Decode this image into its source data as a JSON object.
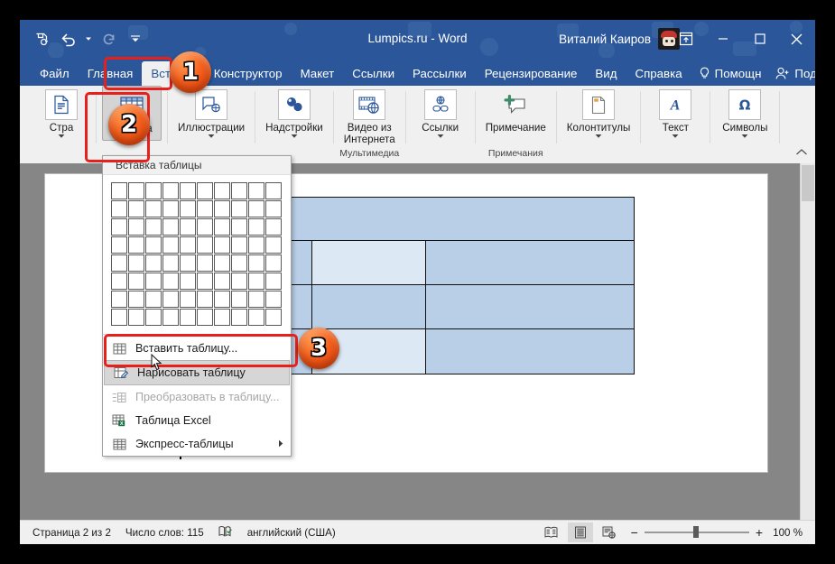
{
  "window": {
    "title": "Lumpics.ru  -  Word",
    "account_name": "Виталий Каиров",
    "controls": {
      "ribbon_display": "ribbon-display-options",
      "minimize": "minimize",
      "maximize": "maximize",
      "close": "close"
    }
  },
  "quick_access": {
    "save_label": "save-sync",
    "undo_label": "undo",
    "redo_label": "redo",
    "customize_label": "customize-quick-access-toolbar"
  },
  "tabs": {
    "items": [
      {
        "label": "Файл",
        "active": false
      },
      {
        "label": "Главная",
        "active": false
      },
      {
        "label": "Вставка",
        "active": true
      },
      {
        "label": "Конструктор",
        "active": false
      },
      {
        "label": "Макет",
        "active": false
      },
      {
        "label": "Ссылки",
        "active": false
      },
      {
        "label": "Рассылки",
        "active": false
      },
      {
        "label": "Рецензирование",
        "active": false
      },
      {
        "label": "Вид",
        "active": false
      },
      {
        "label": "Справка",
        "active": false
      }
    ],
    "tell_me": "Помощн",
    "share": "Поделиться"
  },
  "ribbon": {
    "groups": [
      {
        "label": "",
        "buttons": [
          {
            "name": "pages-button",
            "label": "Стра",
            "icon": "page-icon",
            "caret": true
          }
        ]
      },
      {
        "label": "",
        "buttons": [
          {
            "name": "table-button",
            "label": "Таблица",
            "icon": "table-icon",
            "caret": true
          }
        ]
      },
      {
        "label": "",
        "buttons": [
          {
            "name": "illustrations-button",
            "label": "Иллюстрации",
            "icon": "illustrations-icon",
            "caret": true
          }
        ]
      },
      {
        "label": "",
        "buttons": [
          {
            "name": "addins-button",
            "label": "Надстройки",
            "icon": "addins-icon",
            "caret": true
          }
        ]
      },
      {
        "label": "Мультимедиа",
        "buttons": [
          {
            "name": "online-video-button",
            "label": "Видео из\nИнтернета",
            "icon": "online-video-icon",
            "caret": false
          }
        ]
      },
      {
        "label": "",
        "buttons": [
          {
            "name": "links-button",
            "label": "Ссылки",
            "icon": "links-icon",
            "caret": true
          }
        ]
      },
      {
        "label": "Примечания",
        "buttons": [
          {
            "name": "comment-button",
            "label": "Примечание",
            "icon": "comment-icon",
            "caret": false
          }
        ]
      },
      {
        "label": "",
        "buttons": [
          {
            "name": "headers-footers-button",
            "label": "Колонтитулы",
            "icon": "header-footer-icon",
            "caret": true
          }
        ]
      },
      {
        "label": "",
        "buttons": [
          {
            "name": "text-button",
            "label": "Текст",
            "icon": "text-a-icon",
            "caret": true
          }
        ]
      },
      {
        "label": "",
        "buttons": [
          {
            "name": "symbols-button",
            "label": "Символы",
            "icon": "omega-icon",
            "caret": true
          }
        ]
      }
    ],
    "collapse_icon": "collapse-ribbon-chevron-icon"
  },
  "table_menu": {
    "header": "Вставка таблицы",
    "grid": {
      "columns": 10,
      "rows": 8
    },
    "items": [
      {
        "name": "insert-table-item",
        "label": "Вставить таблицу...",
        "icon": "insert-table-icon",
        "state": "normal",
        "submenu": false
      },
      {
        "name": "draw-table-item",
        "label": "Нарисовать таблицу",
        "icon": "draw-table-icon",
        "state": "highlighted",
        "submenu": false
      },
      {
        "name": "convert-to-table-item",
        "label": "Преобразовать в таблицу...",
        "icon": "convert-table-icon",
        "state": "disabled",
        "submenu": false
      },
      {
        "name": "excel-table-item",
        "label": "Таблица Excel",
        "icon": "excel-table-icon",
        "state": "normal",
        "submenu": false
      },
      {
        "name": "quick-tables-item",
        "label": "Экспресс-таблицы",
        "icon": "quick-tables-icon",
        "state": "normal",
        "submenu": true
      }
    ]
  },
  "document": {
    "table": {
      "header_fill": "#b8cfe7",
      "cells": [
        [
          "#dce8f4",
          "#b8cfe7",
          "#dce8f4",
          "#b8cfe7"
        ],
        [
          "#b8cfe7",
          "#b8cfe7",
          "#b8cfe7",
          "#b8cfe7"
        ],
        [
          "#dce8f4",
          "#b8cfe7",
          "#dce8f4",
          "#b8cfe7"
        ]
      ]
    }
  },
  "status_bar": {
    "page": "Страница 2 из 2",
    "words": "Число слов: 115",
    "proofing_icon": "proofing-icon",
    "language": "английский (США)",
    "views": [
      {
        "name": "read-mode-view-button",
        "icon": "read-mode-icon",
        "active": false
      },
      {
        "name": "print-layout-view-button",
        "icon": "print-layout-icon",
        "active": true
      },
      {
        "name": "web-layout-view-button",
        "icon": "web-layout-icon",
        "active": false
      }
    ],
    "zoom_out": "−",
    "zoom_in": "+",
    "zoom_value": "100 %"
  },
  "annotations": {
    "badges": [
      {
        "name": "step-badge-1",
        "text": "1"
      },
      {
        "name": "step-badge-2",
        "text": "2"
      },
      {
        "name": "step-badge-3",
        "text": "3"
      }
    ],
    "highlight_color": "#e8201b"
  }
}
